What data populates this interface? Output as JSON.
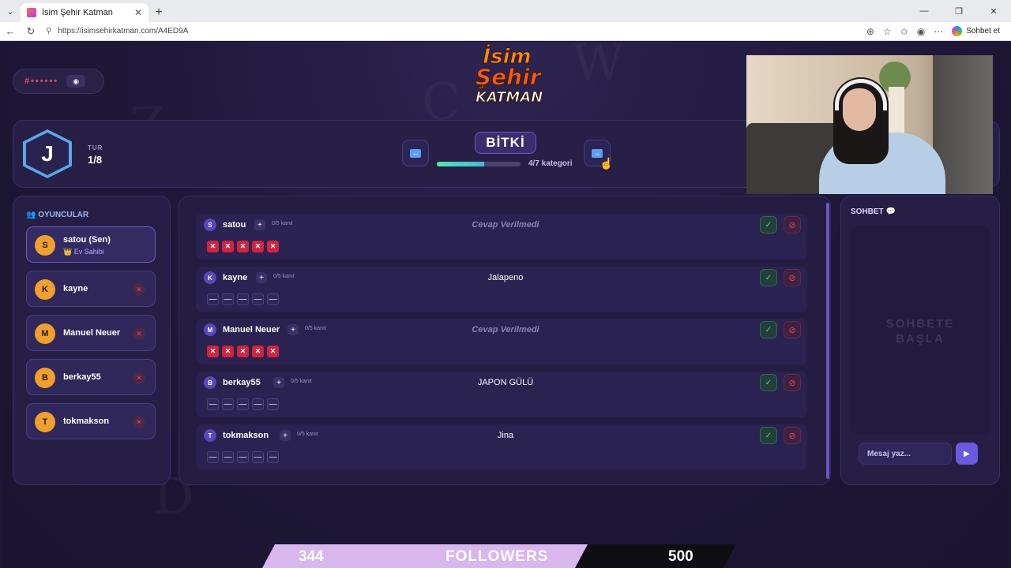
{
  "browser": {
    "tab_title": "İsim Şehir Katman",
    "url": "https://isimsehirkatman.com/A4ED9A",
    "chat_label": "Sohbet et"
  },
  "room": {
    "code": "#••••••"
  },
  "logo": {
    "line1": "İsim",
    "line2": "Şehir",
    "line3": "KATMAN"
  },
  "round": {
    "letter": "J",
    "label": "TUR",
    "value": "1/8",
    "category": "BİTKİ",
    "progress_text": "4/7 kategori",
    "progress_fraction": 0.57
  },
  "players": {
    "title": "OYUNCULAR",
    "host_label": "Ev Sahibi",
    "items": [
      {
        "initial": "S",
        "name": "satou (Sen)"
      },
      {
        "initial": "K",
        "name": "kayne"
      },
      {
        "initial": "M",
        "name": "Manuel Neuer"
      },
      {
        "initial": "B",
        "name": "berkay55"
      },
      {
        "initial": "T",
        "name": "tokmakson"
      }
    ]
  },
  "answers": [
    {
      "initial": "S",
      "name": "satou",
      "proof": "0/5 kanıt",
      "answer": "Cevap Verilmedi",
      "votes": [
        "x",
        "x",
        "x",
        "x",
        "x"
      ]
    },
    {
      "initial": "K",
      "name": "kayne",
      "proof": "0/5 kanıt",
      "answer": "Jalapeno",
      "votes": [
        "—",
        "—",
        "—",
        "—",
        "—"
      ]
    },
    {
      "initial": "M",
      "name": "Manuel Neuer",
      "proof": "0/5 kanıt",
      "answer": "Cevap Verilmedi",
      "votes": [
        "x",
        "x",
        "x",
        "x",
        "x"
      ]
    },
    {
      "initial": "B",
      "name": "berkay55",
      "proof": "0/5 kanıt",
      "answer": "JAPON GÜLÜ",
      "votes": [
        "—",
        "—",
        "—",
        "—",
        "—"
      ]
    },
    {
      "initial": "T",
      "name": "tokmakson",
      "proof": "0/5 kanıt",
      "answer": "Jina",
      "votes": [
        "—",
        "—",
        "—",
        "—",
        "—"
      ]
    }
  ],
  "chat": {
    "title": "SOHBET",
    "empty_line1": "SOHBETE",
    "empty_line2": "BAŞLA",
    "placeholder": "Mesaj yaz..."
  },
  "overlay": {
    "current": "344",
    "label": "FOLLOWERS",
    "goal": "500"
  }
}
